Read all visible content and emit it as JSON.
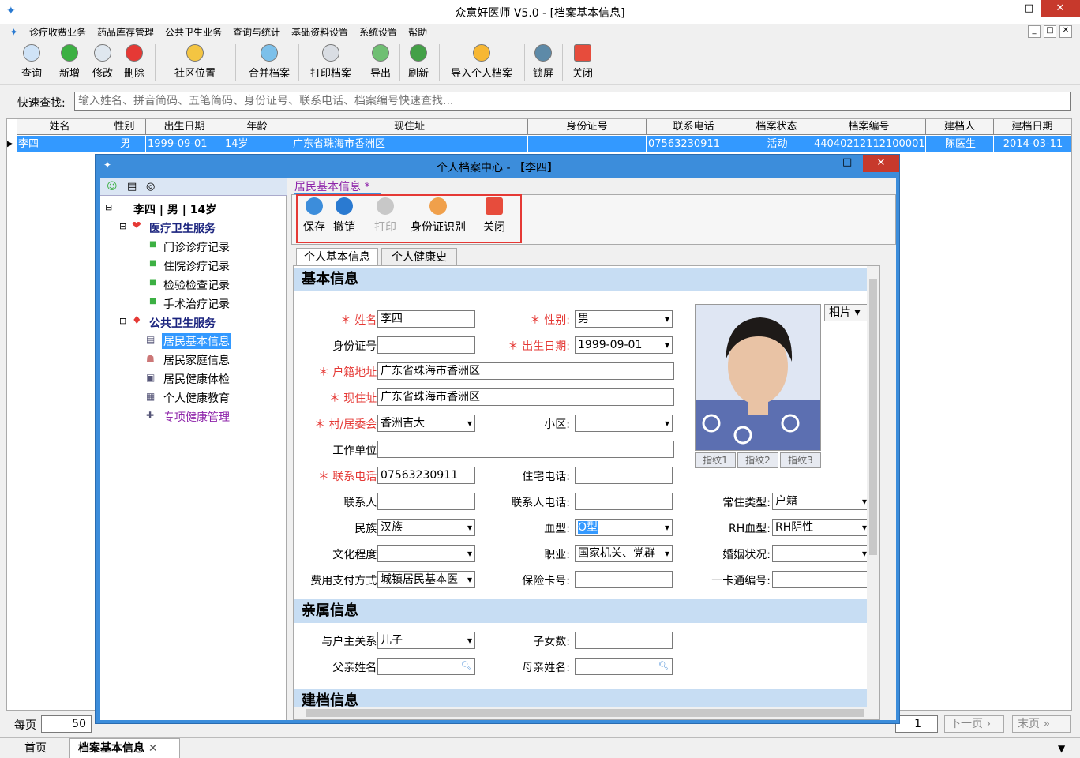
{
  "app": {
    "title": "众意好医师 V5.0 - [档案基本信息]"
  },
  "menu": [
    "诊疗收费业务",
    "药品库存管理",
    "公共卫生业务",
    "查询与统计",
    "基础资料设置",
    "系统设置",
    "帮助"
  ],
  "toolbar": [
    "查询",
    "新增",
    "修改",
    "删除",
    "社区位置",
    "合并档案",
    "打印档案",
    "导出",
    "刷新",
    "导入个人档案",
    "锁屏",
    "关闭"
  ],
  "search": {
    "label": "快速查找:",
    "placeholder": "输入姓名、拼音简码、五笔简码、身份证号、联系电话、档案编号快速查找..."
  },
  "grid": {
    "headers": [
      "姓名",
      "性别",
      "出生日期",
      "年龄",
      "现住址",
      "身份证号",
      "联系电话",
      "档案状态",
      "档案编号",
      "建档人",
      "建档日期"
    ],
    "row": [
      "李四",
      "男",
      "1999-09-01",
      "14岁",
      "广东省珠海市香洲区",
      "",
      "07563230911",
      "活动",
      "44040212112100001",
      "陈医生",
      "2014-03-11"
    ]
  },
  "pager": {
    "per_page_label": "每页",
    "per_page": "50",
    "page": "1",
    "next": "下一页",
    "last": "末页"
  },
  "tabs": {
    "home": "首页",
    "active": "档案基本信息"
  },
  "dialog": {
    "title": "个人档案中心 - 【李四】",
    "tab_label": "居民基本信息 *",
    "tree": {
      "root": "李四 | 男 | 14岁",
      "group1": "医疗卫生服务",
      "group1_items": [
        "门诊诊疗记录",
        "住院诊疗记录",
        "检验检查记录",
        "手术治疗记录"
      ],
      "group2": "公共卫生服务",
      "group2_items": [
        "居民基本信息",
        "居民家庭信息",
        "居民健康体检",
        "个人健康教育",
        "专项健康管理"
      ]
    },
    "subtoolbar": [
      "保存",
      "撤销",
      "打印",
      "身份证识别",
      "关闭"
    ],
    "subtabs": [
      "个人基本信息",
      "个人健康史"
    ],
    "sections": [
      "基本信息",
      "亲属信息",
      "建档信息"
    ],
    "form": {
      "name_label": "姓名:",
      "name": "李四",
      "gender_label": "性别:",
      "gender": "男",
      "id_label": "身份证号:",
      "id": "",
      "dob_label": "出生日期:",
      "dob": "1999-09-01",
      "hukou_label": "户籍地址:",
      "hukou": "广东省珠海市香洲区",
      "addr_label": "现住址:",
      "addr": "广东省珠海市香洲区",
      "village_label": "村/居委会:",
      "village": "香洲吉大",
      "district_label": "小区:",
      "district": "",
      "work_label": "工作单位:",
      "work": "",
      "phone_label": "联系电话:",
      "phone": "07563230911",
      "home_phone_label": "住宅电话:",
      "home_phone": "",
      "contact_label": "联系人:",
      "contact": "",
      "contact_phone_label": "联系人电话:",
      "contact_phone": "",
      "resident_type_label": "常住类型:",
      "resident_type": "户籍",
      "ethnic_label": "民族:",
      "ethnic": "汉族",
      "blood_label": "血型:",
      "blood": "O型",
      "rh_label": "RH血型:",
      "rh": "RH阴性",
      "edu_label": "文化程度:",
      "edu": "",
      "job_label": "职业:",
      "job": "国家机关、党群",
      "marriage_label": "婚姻状况:",
      "marriage": "",
      "pay_label": "费用支付方式:",
      "pay": "城镇居民基本医",
      "insurance_label": "保险卡号:",
      "insurance": "",
      "card_label": "一卡通编号:",
      "card": "",
      "relation_label": "与户主关系:",
      "relation": "儿子",
      "children_label": "子女数:",
      "children": "",
      "father_label": "父亲姓名:",
      "father": "",
      "mother_label": "母亲姓名:",
      "mother": "",
      "photo_btn": "相片",
      "fingerprints": [
        "指纹1",
        "指纹2",
        "指纹3"
      ]
    }
  }
}
